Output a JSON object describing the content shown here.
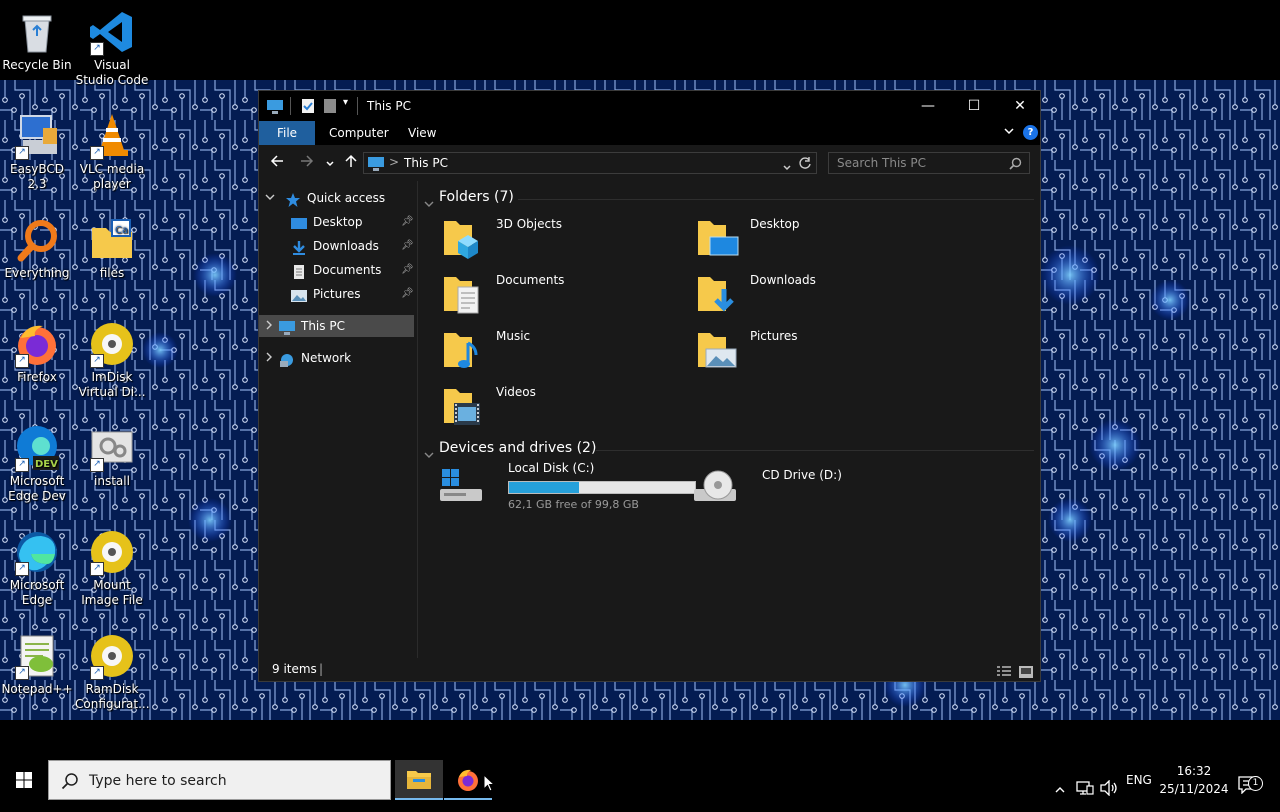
{
  "desktop": {
    "icons": [
      {
        "label": "Recycle Bin"
      },
      {
        "label": "Visual Studio Code"
      },
      {
        "label": "EasyBCD 2.3"
      },
      {
        "label": "VLC media player"
      },
      {
        "label": "Everything"
      },
      {
        "label": "files"
      },
      {
        "label": "Firefox"
      },
      {
        "label": "ImDisk Virtual Di..."
      },
      {
        "label": "Microsoft Edge Dev"
      },
      {
        "label": "install"
      },
      {
        "label": "Microsoft Edge"
      },
      {
        "label": "Mount Image File"
      },
      {
        "label": "Notepad++"
      },
      {
        "label": "RamDisk Configurat..."
      }
    ]
  },
  "window": {
    "title": "This PC",
    "controls": {
      "minimize": "—",
      "maximize": "☐",
      "close": "✕"
    },
    "ribbon_tabs": [
      {
        "label": "File"
      },
      {
        "label": "Computer"
      },
      {
        "label": "View"
      }
    ],
    "address": {
      "separator": ">",
      "path": "This PC"
    },
    "search": {
      "placeholder": "Search This PC"
    },
    "nav_pane": {
      "quick_access": "Quick access",
      "pinned": [
        {
          "label": "Desktop"
        },
        {
          "label": "Downloads"
        },
        {
          "label": "Documents"
        },
        {
          "label": "Pictures"
        }
      ],
      "this_pc": "This PC",
      "network": "Network"
    },
    "content": {
      "folders_header": "Folders (7)",
      "folders": [
        {
          "name": "3D Objects"
        },
        {
          "name": "Desktop"
        },
        {
          "name": "Documents"
        },
        {
          "name": "Downloads"
        },
        {
          "name": "Music"
        },
        {
          "name": "Pictures"
        },
        {
          "name": "Videos"
        }
      ],
      "drives_header": "Devices and drives (2)",
      "drives": [
        {
          "name": "Local Disk (C:)",
          "free_text": "62,1 GB free of 99,8 GB",
          "used_fraction": 0.378
        },
        {
          "name": "CD Drive (D:)"
        }
      ]
    },
    "status": {
      "item_count": "9 items",
      "cursor": "|"
    }
  },
  "taskbar": {
    "search_placeholder": "Type here to search",
    "language": "ENG",
    "time": "16:32",
    "date": "25/11/2024",
    "notification_count": "1"
  },
  "colors": {
    "accent": "#26a0da",
    "window_bg": "#191919",
    "title_bg": "#000000",
    "file_tab": "#1f5f9e",
    "folder_yellow": "#f6c94b",
    "wallpaper": "#031a4a"
  }
}
